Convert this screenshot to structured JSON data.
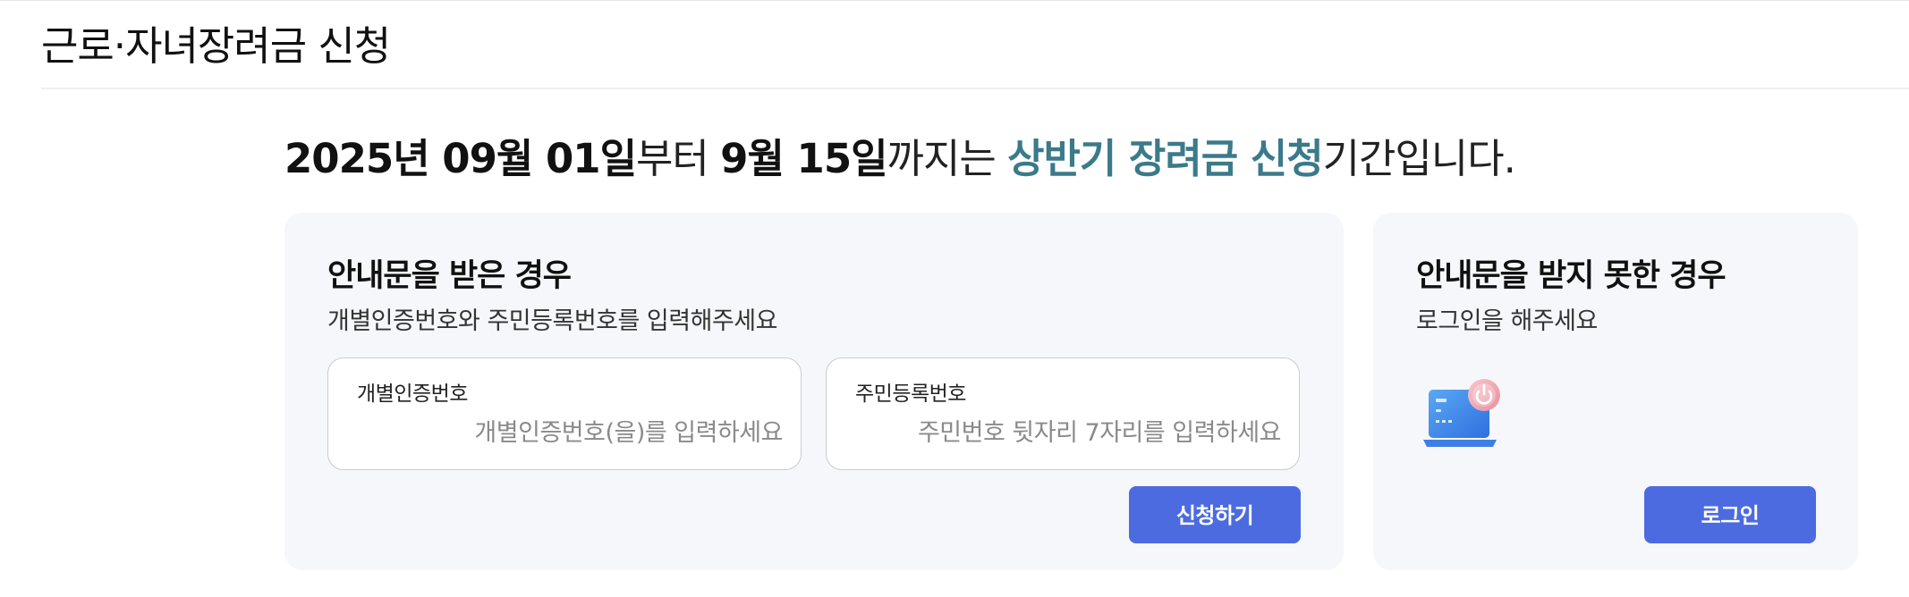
{
  "header": {
    "title": "근로·자녀장려금 신청"
  },
  "notice": {
    "start_date": "2025년 09월 01일",
    "from_text": "부터 ",
    "end_date": "9월 15일",
    "until_text": "까지는 ",
    "period_name": "상반기 장려금 신청",
    "suffix": "기간입니다."
  },
  "received_card": {
    "heading": "안내문을 받은 경우",
    "subtitle": "개별인증번호와 주민등록번호를 입력해주세요",
    "auth_field": {
      "label": "개별인증번호",
      "value": "",
      "placeholder": "개별인증번호(을)를 입력하세요"
    },
    "resident_field": {
      "label": "주민등록번호",
      "value": "",
      "placeholder": "주민번호 뒷자리 7자리를 입력하세요"
    },
    "submit_label": "신청하기"
  },
  "not_received_card": {
    "heading": "안내문을 받지 못한 경우",
    "subtitle": "로그인을 해주세요",
    "illustration_icon": "laptop-power-icon",
    "login_label": "로그인"
  },
  "colors": {
    "accent_text": "#3b7a8a",
    "button": "#4d6be0",
    "card_bg": "#f6f7fb"
  }
}
